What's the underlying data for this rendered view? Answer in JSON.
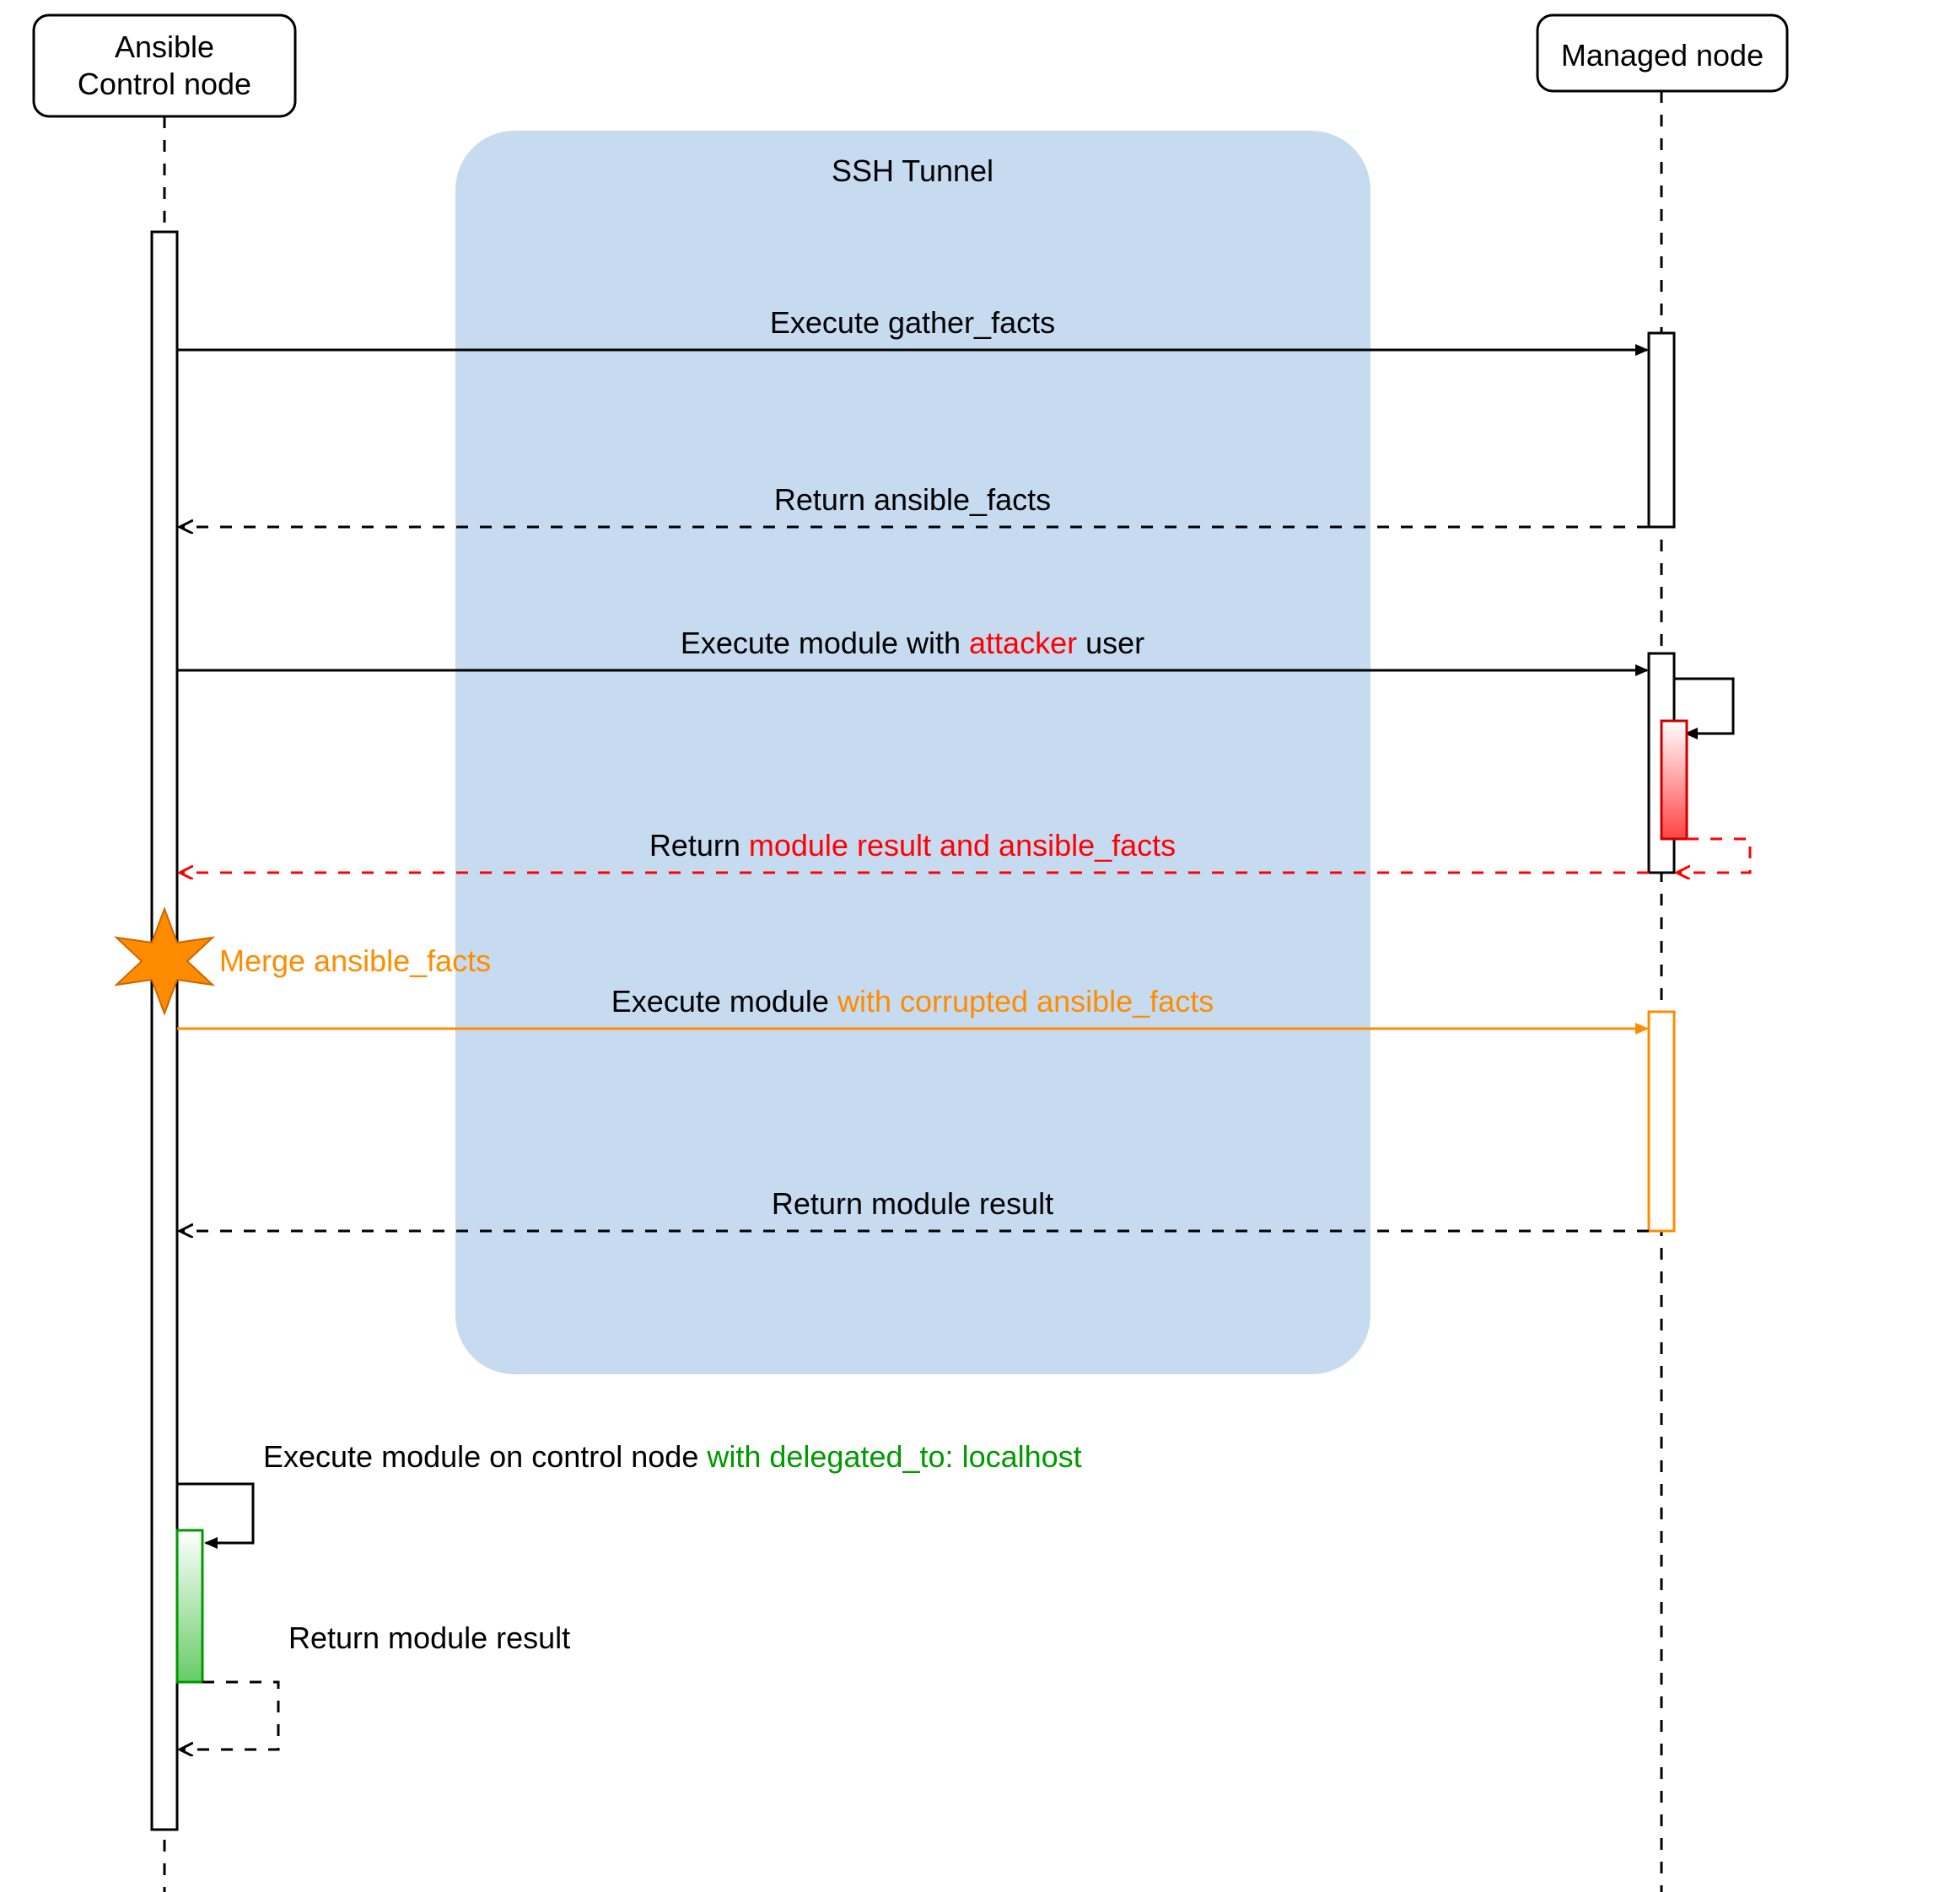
{
  "participants": {
    "control": {
      "line1": "Ansible",
      "line2": "Control node"
    },
    "managed": {
      "label": "Managed node"
    }
  },
  "ssh_tunnel": {
    "label": "SSH Tunnel"
  },
  "messages": {
    "m1": "Execute gather_facts",
    "m2": "Return ansible_facts",
    "m3_prefix": "Execute module with ",
    "m3_attacker": "attacker",
    "m3_suffix": " user",
    "m4_prefix": "Return ",
    "m4_red": "module result and ansible_facts",
    "merge": "Merge ansible_facts",
    "m5_prefix": "Execute module ",
    "m5_orange": "with corrupted ansible_facts",
    "m6": "Return module result",
    "m7_prefix": "Execute module on control node ",
    "m7_green": "with delegated_to: localhost",
    "m8": "Return module result"
  },
  "colors": {
    "ssh_bg": "#c6dbf0",
    "attacker_red": "#ff0000",
    "orange": "#ff8c00",
    "green": "#009900"
  },
  "chart_data": {
    "type": "sequence_diagram",
    "participants": [
      "Ansible Control node",
      "Managed node"
    ],
    "annotations": [
      {
        "kind": "region",
        "label": "SSH Tunnel",
        "covers_messages": [
          1,
          2,
          3,
          4,
          5,
          6
        ]
      }
    ],
    "messages": [
      {
        "from": "Ansible Control node",
        "to": "Managed node",
        "label": "Execute gather_facts",
        "style": "solid",
        "dir": "sync"
      },
      {
        "from": "Managed node",
        "to": "Ansible Control node",
        "label": "Return ansible_facts",
        "style": "dashed",
        "dir": "return"
      },
      {
        "from": "Ansible Control node",
        "to": "Managed node",
        "label": "Execute module with attacker user",
        "style": "solid",
        "dir": "sync",
        "note": "attacker highlighted red"
      },
      {
        "self": "Managed node",
        "label": "",
        "style": "solid",
        "activation": "red-gradient"
      },
      {
        "from": "Managed node",
        "to": "Ansible Control node",
        "label": "Return module result and ansible_facts",
        "style": "dashed",
        "dir": "return",
        "color": "red"
      },
      {
        "marker": "Ansible Control node",
        "label": "Merge ansible_facts",
        "shape": "star",
        "color": "orange"
      },
      {
        "from": "Ansible Control node",
        "to": "Managed node",
        "label": "Execute module with corrupted ansible_facts",
        "style": "solid",
        "dir": "sync",
        "color": "orange",
        "activation": "orange"
      },
      {
        "from": "Managed node",
        "to": "Ansible Control node",
        "label": "Return module result",
        "style": "dashed",
        "dir": "return"
      },
      {
        "self": "Ansible Control node",
        "label": "Execute module on control node with delegated_to: localhost",
        "style": "solid",
        "activation": "green"
      },
      {
        "self": "Ansible Control node",
        "label": "Return module result",
        "style": "dashed",
        "dir": "return"
      }
    ]
  }
}
